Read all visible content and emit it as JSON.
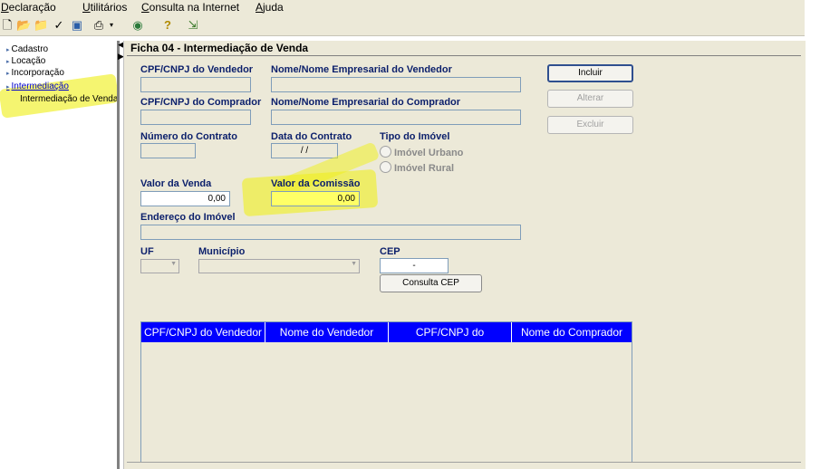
{
  "menu": [
    "Declaração",
    "Utilitários",
    "Consulta na Internet",
    "Ajuda"
  ],
  "toolbar": {
    "icons": [
      "new-icon",
      "open-icon",
      "folder-icon",
      "check-icon",
      "save-icon",
      "print-icon",
      "dropdown-icon",
      "globe-icon",
      "help-icon",
      "exit-icon"
    ]
  },
  "tree": {
    "items": [
      {
        "label": "Cadastro"
      },
      {
        "label": "Locação"
      },
      {
        "label": "Incorporação"
      },
      {
        "label": "Intermediação"
      },
      {
        "label": "Intermediação de Venda"
      }
    ]
  },
  "form": {
    "title": "Ficha 04 - Intermediação de Venda",
    "labels": {
      "cpf_vendedor": "CPF/CNPJ do Vendedor",
      "nome_vendedor": "Nome/Nome Empresarial do Vendedor",
      "cpf_comprador": "CPF/CNPJ do Comprador",
      "nome_comprador": "Nome/Nome Empresarial do Comprador",
      "numero_contrato": "Número do Contrato",
      "data_contrato": "Data do Contrato",
      "tipo_imovel": "Tipo do Imóvel",
      "valor_venda": "Valor da Venda",
      "valor_comissao": "Valor da Comissão",
      "endereco": "Endereço do Imóvel",
      "uf": "UF",
      "municipio": "Município",
      "cep": "CEP"
    },
    "values": {
      "data_contrato": "/ /",
      "valor_venda": "0,00",
      "valor_comissao": "0,00",
      "cep": "-"
    },
    "radio": {
      "urbano": "Imóvel Urbano",
      "rural": "Imóvel Rural"
    },
    "buttons": {
      "incluir": "Incluir",
      "alterar": "Alterar",
      "excluir": "Excluir",
      "consulta_cep": "Consulta CEP"
    },
    "grid_columns": [
      "CPF/CNPJ do Vendedor",
      "Nome do Vendedor",
      "CPF/CNPJ do",
      "Nome do Comprador"
    ]
  },
  "colors": {
    "highlight": "#f0f01e",
    "grid_header": "#0000ff",
    "label": "#0b1f6b",
    "panel": "#ece9d8"
  }
}
